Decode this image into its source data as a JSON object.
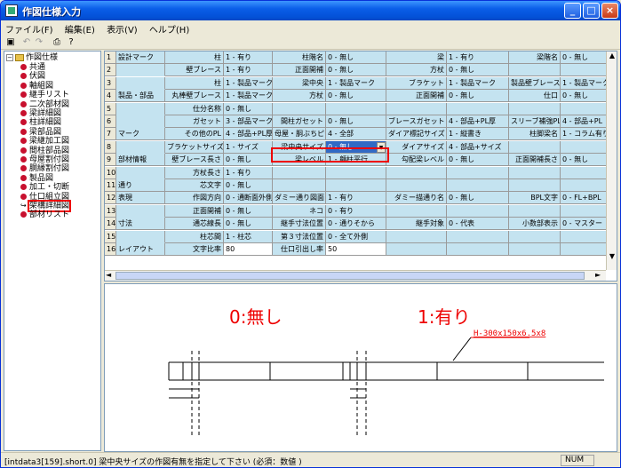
{
  "window": {
    "title": "作図仕様入力"
  },
  "menu": [
    "ファイル(F)",
    "編集(E)",
    "表示(V)",
    "ヘルプ(H)"
  ],
  "tree": {
    "root": "作図仕様",
    "items": [
      "共通",
      "伏図",
      "軸組図",
      "継手リスト",
      "二次部材図",
      "梁詳細図",
      "柱詳細図",
      "梁部品図",
      "梁継加工図",
      "間柱部品図",
      "母屋割付図",
      "胴縁割付図",
      "製品図",
      "加工・切断",
      "仕口組立図",
      "架構詳細図",
      "部材リスト"
    ],
    "selected_index": 15
  },
  "grid": {
    "rows": [
      {
        "n": "1",
        "cat": "設計マーク",
        "cells": [
          [
            "柱",
            "1 - 有り"
          ],
          [
            "柱階名",
            "0 - 無し"
          ],
          [
            "梁",
            "1 - 有り"
          ],
          [
            "梁階名",
            "0 - 無し"
          ]
        ]
      },
      {
        "n": "2",
        "cat": "",
        "cells": [
          [
            "壁ブレース",
            "1 - 有り"
          ],
          [
            "正面開補",
            "0 - 無し"
          ],
          [
            "方杖",
            "0 - 無し"
          ],
          [
            "",
            ""
          ]
        ]
      },
      {
        "n": "3",
        "cat": "",
        "cells": [
          [
            "柱",
            "1 - 製品マーク"
          ],
          [
            "梁中央",
            "1 - 製品マーク"
          ],
          [
            "ブラケット",
            "1 - 製品マーク"
          ],
          [
            "製品壁ブレース",
            "1 - 製品マーク"
          ]
        ]
      },
      {
        "n": "4",
        "cat": "製品・部品",
        "cells": [
          [
            "丸棒壁ブレース",
            "1 - 製品マーク"
          ],
          [
            "方杖",
            "0 - 無し"
          ],
          [
            "正面開補",
            "0 - 無し"
          ],
          [
            "仕口",
            "0 - 無し"
          ]
        ]
      },
      {
        "n": "5",
        "cat": "",
        "cells": [
          [
            "仕分名称",
            "0 - 無し"
          ],
          [
            "",
            ""
          ],
          [
            "",
            ""
          ],
          [
            "",
            ""
          ]
        ]
      },
      {
        "n": "6",
        "cat": "",
        "cells": [
          [
            "ガセット",
            "3 - 部品マーク"
          ],
          [
            "間柱ガセット",
            "0 - 無し"
          ],
          [
            "ブレースガセット",
            "4 - 部品+PL厚"
          ],
          [
            "スリーブ補強PL",
            "4 - 部品+PL"
          ]
        ]
      },
      {
        "n": "7",
        "cat": "マーク",
        "cells": [
          [
            "その他のPL",
            "4 - 部品+PL厚"
          ],
          [
            "母屋・胴ぶちピース",
            "4 - 全部"
          ],
          [
            "ダイア標記サイズ",
            "1 - 縦書き"
          ],
          [
            "柱脚梁名",
            "1 - コラム有り"
          ]
        ]
      },
      {
        "n": "8",
        "cat": "",
        "cells": [
          [
            "ブラケットサイズ",
            "1 - サイズ"
          ],
          [
            "梁中央サイズ",
            "0 - 無し"
          ],
          [
            "ダイアサイズ",
            "4 - 部品+サイズ"
          ],
          [
            "",
            ""
          ]
        ]
      },
      {
        "n": "9",
        "cat": "部材情報",
        "cells": [
          [
            "壁ブレース長さ",
            "0 - 無し"
          ],
          [
            "梁レベル",
            "1 - 顧柱平行"
          ],
          [
            "勾配梁レベル",
            "0 - 無し"
          ],
          [
            "正面開補長さ",
            "0 - 無し"
          ]
        ]
      },
      {
        "n": "10",
        "cat": "",
        "cells": [
          [
            "方杖長さ",
            "1 - 有り"
          ],
          [
            "",
            ""
          ],
          [
            "",
            ""
          ],
          [
            "",
            ""
          ]
        ]
      },
      {
        "n": "11",
        "cat": "通り",
        "cells": [
          [
            "芯文字",
            "0 - 無し"
          ],
          [
            "",
            ""
          ],
          [
            "",
            ""
          ],
          [
            "",
            ""
          ]
        ]
      },
      {
        "n": "12",
        "cat": "表現",
        "cells": [
          [
            "作図方向",
            "0 - 通断面外側"
          ],
          [
            "ダミー通り図面",
            "1 - 有り"
          ],
          [
            "ダミー描通り名",
            "0 - 無し"
          ],
          [
            "BPL文字",
            "0 - FL+BPL"
          ]
        ]
      },
      {
        "n": "13",
        "cat": "",
        "cells": [
          [
            "正面開補",
            "0 - 無し"
          ],
          [
            "ネコ",
            "0 - 有り"
          ],
          [
            "",
            ""
          ],
          [
            "",
            ""
          ]
        ]
      },
      {
        "n": "14",
        "cat": "寸法",
        "cells": [
          [
            "通芯線長",
            "0 - 無し"
          ],
          [
            "継手寸法位置",
            "0 - 通りそから"
          ],
          [
            "継手対象",
            "0 - 代表"
          ],
          [
            "小数部表示",
            "0 - マスター"
          ]
        ]
      },
      {
        "n": "15",
        "cat": "",
        "cells": [
          [
            "柱芯間",
            "1 - 柱芯"
          ],
          [
            "第３寸法位置",
            "0 - 全て外側"
          ],
          [
            "",
            ""
          ],
          [
            "",
            ""
          ]
        ]
      },
      {
        "n": "16",
        "cat": "レイアウト",
        "cells": [
          [
            "文字比率",
            "80"
          ],
          [
            "仕口引出し率",
            "50"
          ],
          [
            "",
            ""
          ],
          [
            "",
            ""
          ]
        ]
      }
    ]
  },
  "preview": {
    "left_label": "0:無し",
    "right_label": "1:有り",
    "annotation": "H-300x150x6.5x8"
  },
  "status": {
    "message": "[intdata3[159].short.0] 梁中央サイズの作図有無を指定して下さい (必須：数値 )",
    "num": "NUM"
  },
  "colors": {
    "grid_bg": "#c4e3f0",
    "highlight": "#ee0000",
    "preview_text": "#ee0000"
  }
}
